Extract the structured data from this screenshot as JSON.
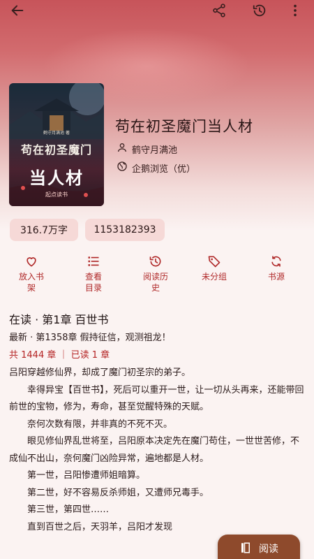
{
  "book": {
    "title": "苟在初圣魔门当人材",
    "author": "鹤守月满池",
    "source": "企鹅浏览（优）",
    "cover_title_line1": "苟在初圣魔门",
    "cover_title_line2": "当人材",
    "cover_publisher": "起点读书",
    "cover_small": "鹤守月满池 著"
  },
  "stats": {
    "word_count": "316.7万字",
    "number": "1153182393"
  },
  "actions": [
    {
      "label": "放入书架",
      "icon": "bookmark-icon"
    },
    {
      "label": "查看目录",
      "icon": "list-icon"
    },
    {
      "label": "阅读历史",
      "icon": "history-icon"
    },
    {
      "label": "未分组",
      "icon": "tag-icon"
    },
    {
      "label": "书源",
      "icon": "refresh-icon"
    }
  ],
  "progress": {
    "reading": "在读 · 第1章 百世书",
    "latest": "最新 · 第1358章 假持征信，观测祖龙！",
    "count": "共 1444 章 ｜ 已读 1 章"
  },
  "description": [
    "吕阳穿越修仙界，却成了魔门初圣宗的弟子。",
    "幸得异宝【百世书】，死后可以重开一世，让一切从头再来，还能带回前世的宝物，修为，寿命，甚至觉醒特殊的天赋。",
    "奈何次数有限，并非真的不死不灭。",
    "眼见修仙界乱世将至，吕阳原本决定先在魔门苟住，一世世苦修，不成仙不出山，奈何魔门凶险异常，遍地都是人材。",
    "第一世，吕阳惨遭师姐暗算。",
    "第二世，好不容易反杀师姐，又遭师兄毒手。",
    "第三世，第四世……",
    "直到百世之后，天羽羊，吕阳才发现"
  ],
  "read_button": "阅读",
  "colors": {
    "accent": "#b02a2a",
    "chip_bg": "#f6d9d7",
    "button_bg": "#8e4a2c"
  }
}
